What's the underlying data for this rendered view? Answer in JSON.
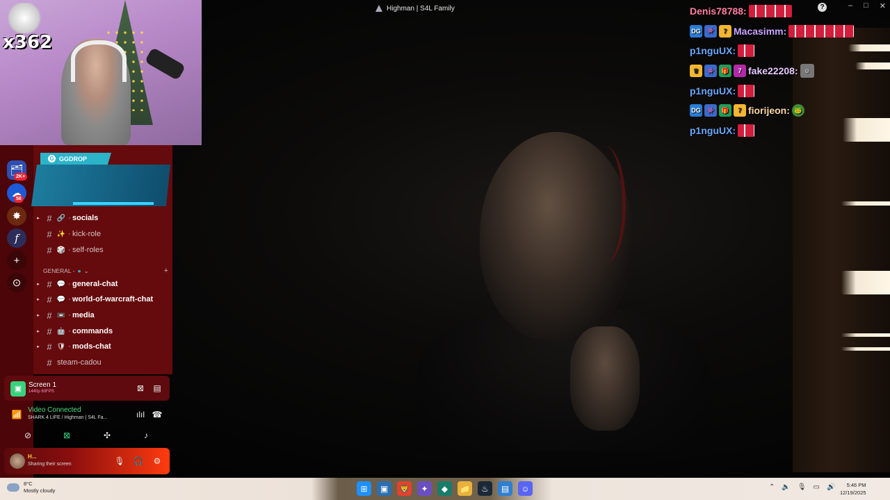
{
  "window": {
    "title": "Highman | S4L Family",
    "controls": [
      "–",
      "□",
      "✕"
    ]
  },
  "webcam": {
    "overlay_count": "x362"
  },
  "chat": {
    "messages": [
      {
        "user": "Denis78788:",
        "color": "#ff7fa0",
        "badges": []
      },
      {
        "user": "Macasimm:",
        "color": "#c8a4ff",
        "badges": [
          "DG",
          "ghost",
          "7tv"
        ]
      },
      {
        "user": "p1nguUX:",
        "color": "#6aa7ff",
        "badges": []
      },
      {
        "user": "fake22208:",
        "color": "#e8c8ff",
        "badges": [
          "crown",
          "ghost",
          "gift",
          "7tv-purple"
        ]
      },
      {
        "user": "p1nguUX:",
        "color": "#6aa7ff",
        "badges": []
      },
      {
        "user": "fiorijeon:",
        "color": "#ffd7a8",
        "badges": [
          "DG",
          "ghost",
          "gift",
          "7tv"
        ]
      },
      {
        "user": "p1nguUX:",
        "color": "#6aa7ff",
        "badges": []
      }
    ]
  },
  "servers": {
    "badge_count_1": "2K+",
    "badge_count_2": "58"
  },
  "promo": {
    "label": "GGDROP"
  },
  "channels": {
    "top": [
      {
        "name": "socials",
        "icon": "🔗",
        "bold": true
      },
      {
        "name": "kick-role",
        "icon": "✨",
        "bold": false
      },
      {
        "name": "self-roles",
        "icon": "🎲",
        "bold": false
      }
    ],
    "category": "GENERAL -",
    "general": [
      {
        "name": "general-chat",
        "icon": "💬",
        "bold": true
      },
      {
        "name": "world-of-warcraft-chat",
        "icon": "💬",
        "bold": true
      },
      {
        "name": "media",
        "icon": "📼",
        "bold": true
      },
      {
        "name": "commands",
        "icon": "🤖",
        "bold": true
      },
      {
        "name": "mods-chat",
        "icon": "🛡",
        "bold": true
      },
      {
        "name": "steam-cadou",
        "icon": "",
        "bold": false
      }
    ]
  },
  "screen_share": {
    "title": "Screen 1",
    "quality": "1440p 60FPS"
  },
  "voice": {
    "status": "Video Connected",
    "location": "SHARK 4 LIFE / Highman | S4L Fa..."
  },
  "user": {
    "name": "H...",
    "status": "Sharing their screen"
  },
  "taskbar": {
    "temperature": "8°C",
    "weather": "Mostly cloudy",
    "time": "5:46 PM",
    "date": "12/19/2025"
  }
}
